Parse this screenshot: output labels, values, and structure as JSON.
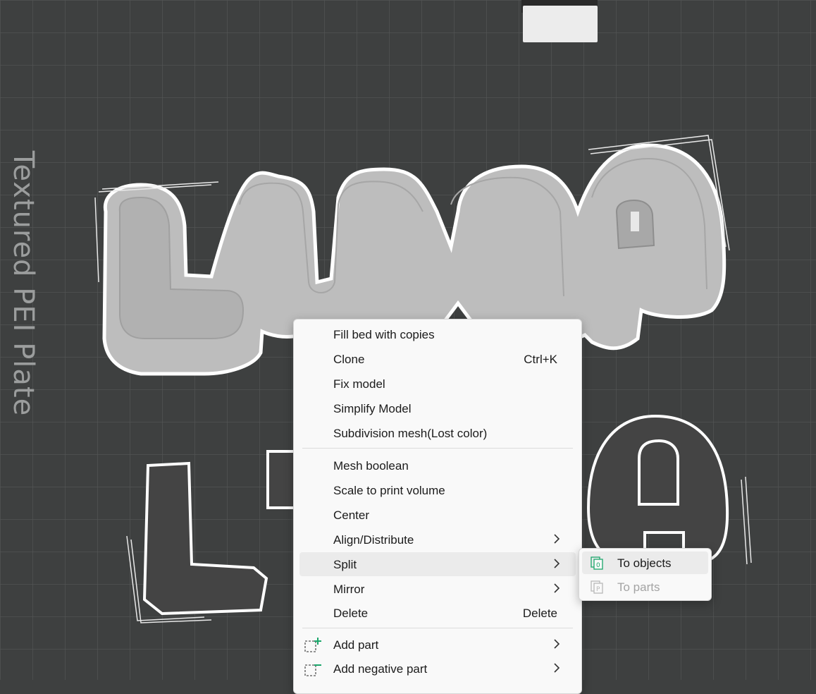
{
  "bed": {
    "plate_label": "Textured PEI Plate"
  },
  "context_menu": {
    "items": [
      {
        "label": "Fill bed with copies"
      },
      {
        "label": "Clone",
        "shortcut": "Ctrl+K"
      },
      {
        "label": "Fix model"
      },
      {
        "label": "Simplify Model"
      },
      {
        "label": "Subdivision mesh(Lost color)"
      },
      {
        "label": "Mesh boolean"
      },
      {
        "label": "Scale to print volume"
      },
      {
        "label": "Center"
      },
      {
        "label": "Align/Distribute"
      },
      {
        "label": "Split"
      },
      {
        "label": "Mirror"
      },
      {
        "label": "Delete",
        "shortcut": "Delete"
      },
      {
        "label": "Add part"
      },
      {
        "label": "Add negative part"
      }
    ]
  },
  "split_submenu": {
    "items": [
      {
        "label": "To objects",
        "icon": "to-objects-icon"
      },
      {
        "label": "To parts",
        "icon": "to-parts-icon",
        "disabled": true
      }
    ]
  },
  "colors": {
    "accent": "#1aa66a",
    "bed": "#3e4040",
    "grid": "#4c4e4e",
    "model": "#b8b8b8"
  }
}
